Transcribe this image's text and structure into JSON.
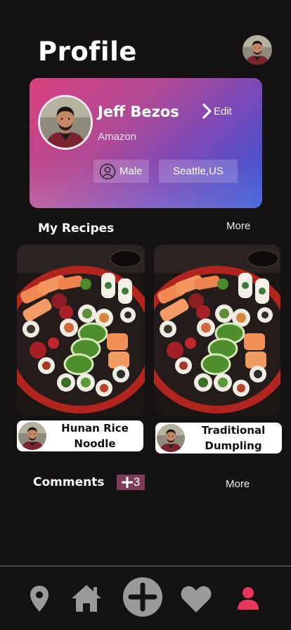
{
  "header": {
    "title": "Profile"
  },
  "profile": {
    "name": "Jeff Bezos",
    "company": "Amazon",
    "edit_label": "Edit",
    "gender": "Male",
    "location": "Seattle,US"
  },
  "recipes_section": {
    "title": "My Recipes",
    "more_label": "More",
    "items": [
      {
        "name": "Hunan Rice Noodle"
      },
      {
        "name": "Traditional Dumpling"
      }
    ]
  },
  "comments_section": {
    "title": "Comments",
    "badge_count": "3",
    "more_label": "More"
  },
  "colors": {
    "background": "#141212",
    "active_nav": "#e8365d",
    "inactive_nav": "#9a9a9a",
    "badge": "#7f3c5a"
  },
  "nav": {
    "items": [
      "location-icon",
      "home-icon",
      "add-icon",
      "heart-icon",
      "profile-icon"
    ],
    "active": "profile-icon"
  }
}
